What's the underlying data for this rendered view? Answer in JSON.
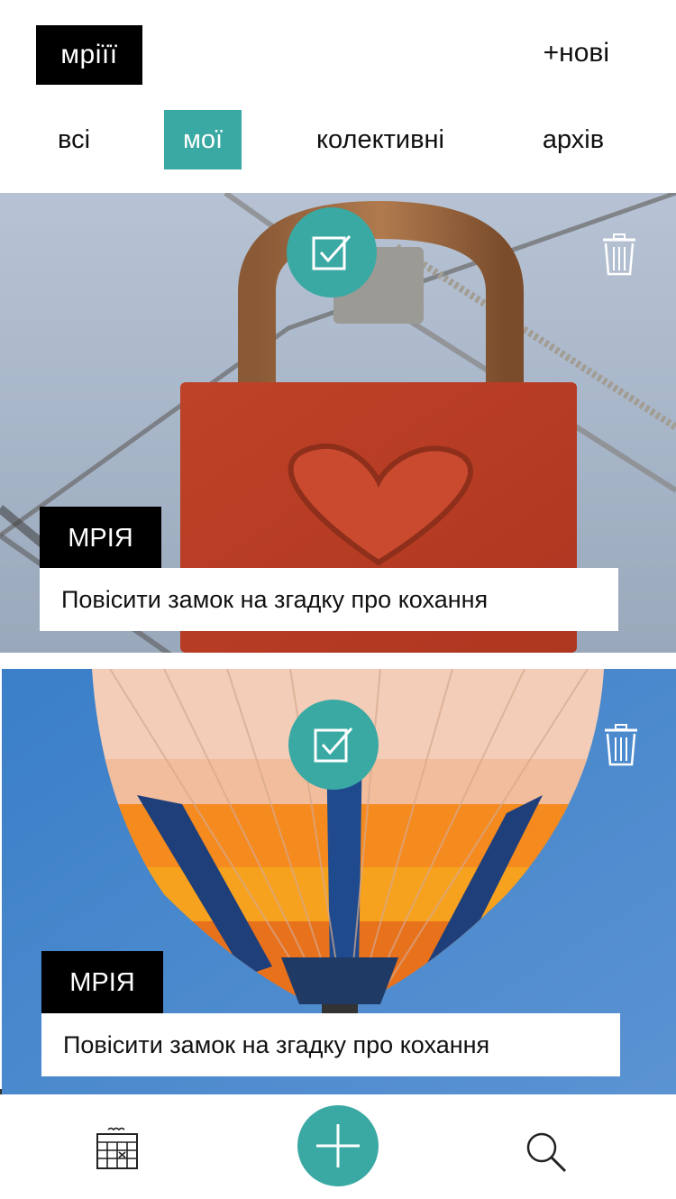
{
  "header": {
    "logo": "мріїї",
    "new_label": "+нові"
  },
  "tabs": [
    {
      "label": "всі",
      "active": false
    },
    {
      "label": "мої",
      "active": true
    },
    {
      "label": "колективні",
      "active": false
    },
    {
      "label": "архів",
      "active": false
    }
  ],
  "cards": [
    {
      "tag": "МРІЯ",
      "text": "Повісити замок на згадку про кохання",
      "image": "red-heart-padlock"
    },
    {
      "tag": "МРІЯ",
      "text": "Повісити замок на згадку про кохання",
      "image": "hot-air-balloon"
    }
  ],
  "icons": {
    "check": "checkbox-icon",
    "trash": "trash-icon",
    "calendar": "calendar-icon",
    "add": "plus-icon",
    "search": "search-icon"
  },
  "colors": {
    "accent": "#3aa9a4",
    "black": "#000000",
    "white": "#ffffff"
  }
}
